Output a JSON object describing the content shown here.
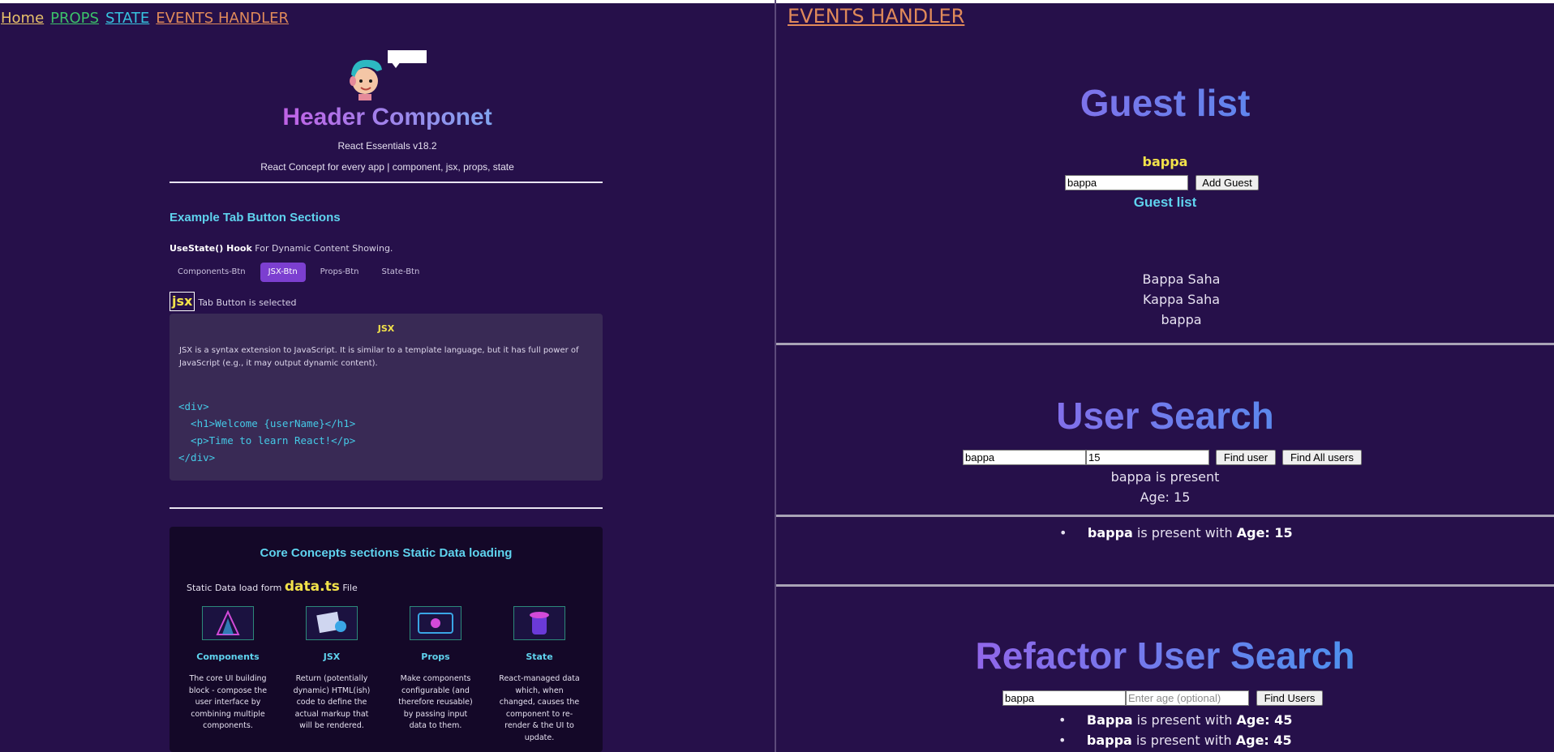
{
  "nav": {
    "home": "Home",
    "props": "PROPS",
    "state": "STATE",
    "events": "EVENTS HANDLER"
  },
  "header": {
    "title": "Header Componet",
    "version": "React Essentials v18.2",
    "tagline": "React Concept for every app | component, jsx, props, state"
  },
  "tabs_section": {
    "title": "Example Tab Button Sections",
    "hook_bold": "UseState() Hook",
    "hook_text": "For Dynamic Content Showing.",
    "tabs": [
      "Components-Btn",
      "JSX-Btn",
      "Props-Btn",
      "State-Btn"
    ],
    "selected_badge": "jsx",
    "selected_text": "Tab Button is selected",
    "card_title": "JSX",
    "card_desc": "JSX is a syntax extension to JavaScript. It is similar to a template language, but it has full power of JavaScript (e.g., it may output dynamic content).",
    "code": "<div>\n  <h1>Welcome {userName}</h1>\n  <p>Time to learn React!</p>\n</div>"
  },
  "core": {
    "title": "Core Concepts sections Static Data loading",
    "sub_prefix": "Static Data load form",
    "sub_file": "data.ts",
    "sub_suffix": "File",
    "items": [
      {
        "name": "Components",
        "desc": "The core UI building block - compose the user interface by combining multiple components."
      },
      {
        "name": "JSX",
        "desc": "Return (potentially dynamic) HTML(ish) code to define the actual markup that will be rendered."
      },
      {
        "name": "Props",
        "desc": "Make components configurable (and therefore reusable) by passing input data to them."
      },
      {
        "name": "State",
        "desc": "React-managed data which, when changed, causes the component to re-render & the UI to update."
      }
    ]
  },
  "events": {
    "nav": "EVENTS HANDLER",
    "guest": {
      "title": "Guest list",
      "current_name": "bappa",
      "input_value": "bappa",
      "add_button": "Add Guest",
      "subtitle": "Guest list",
      "guests": [
        "Bappa Saha",
        "Kappa Saha",
        "bappa"
      ]
    },
    "user_search": {
      "title": "User Search",
      "name_value": "bappa",
      "age_value": "15",
      "find_button": "Find user",
      "find_all_button": "Find All users",
      "result_line1": "bappa is present",
      "result_line2": "Age: 15",
      "list": [
        {
          "name": "bappa",
          "mid": "is present with",
          "age": "Age: 15"
        }
      ]
    },
    "refactor_search": {
      "title": "Refactor User Search",
      "name_value": "bappa",
      "age_placeholder": "Enter age (optional)",
      "find_button": "Find Users",
      "list": [
        {
          "name": "Bappa",
          "mid": "is present with",
          "age": "Age: 45"
        },
        {
          "name": "bappa",
          "mid": "is present with",
          "age": "Age: 45"
        }
      ]
    }
  },
  "colors": {
    "background": "#26104a",
    "accent": "#7c3fd0",
    "cyan": "#5fd3ee",
    "yellow": "#f2e24a"
  }
}
